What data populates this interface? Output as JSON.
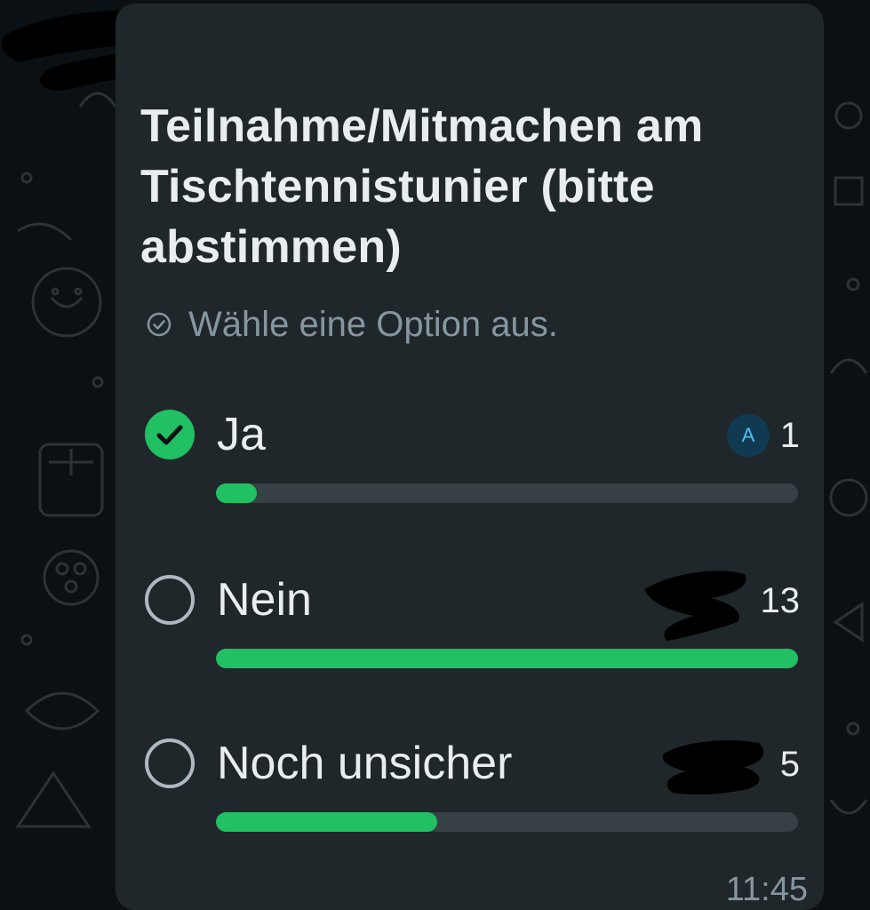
{
  "poll": {
    "title": "Teilnahme/Mitmachen am Tischtennistunier (bitte abstimmen)",
    "hint": "Wähle eine Option aus.",
    "hint_icon": "check-circle-outline-icon",
    "options": [
      {
        "label": "Ja",
        "count": "1",
        "selected": true,
        "voter_initial": "A",
        "fraction": 0.07
      },
      {
        "label": "Nein",
        "count": "13",
        "selected": false,
        "fraction": 1.0
      },
      {
        "label": "Noch unsicher",
        "count": "5",
        "selected": false,
        "fraction": 0.38
      }
    ],
    "time": "11:45"
  },
  "colors": {
    "accent": "#21c063",
    "bubble": "#1f272a",
    "track": "#374045",
    "text": "#e9edef",
    "muted": "#8696a0"
  }
}
